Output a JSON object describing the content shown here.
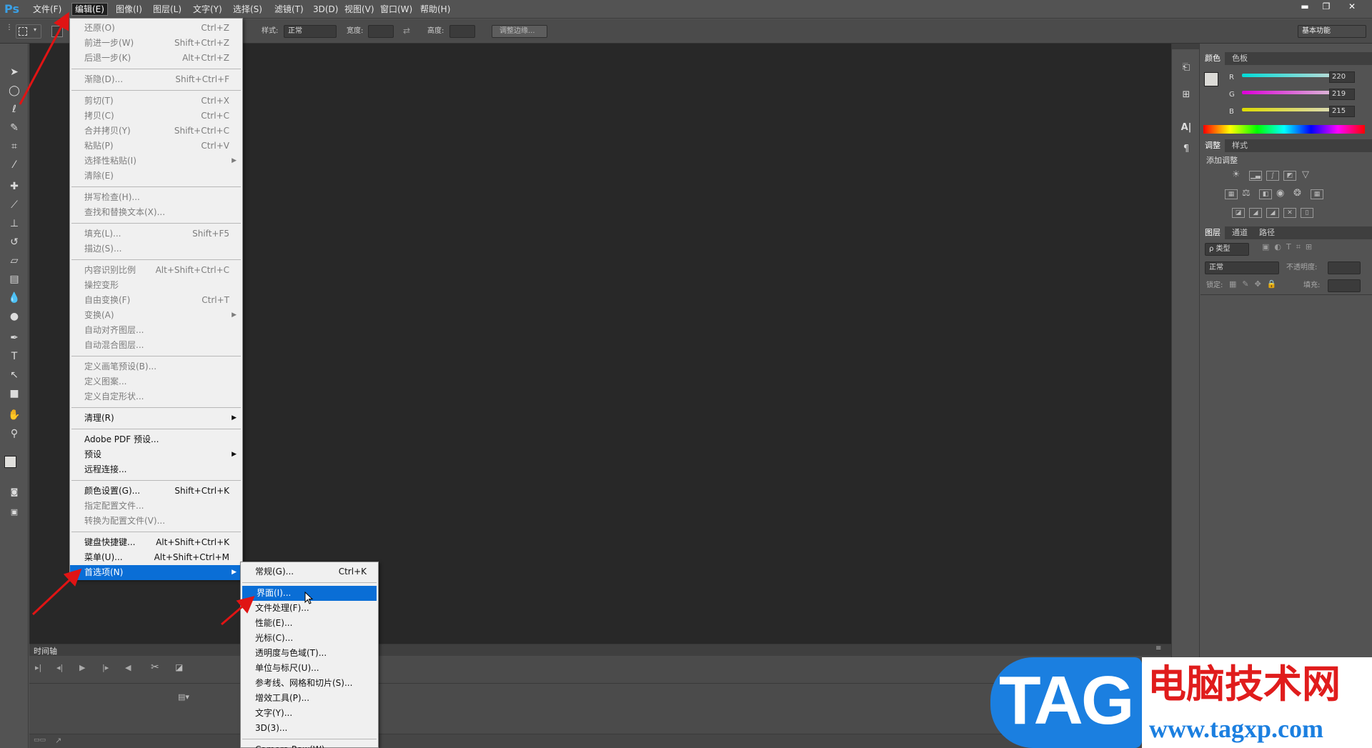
{
  "app": {
    "logo": "Ps"
  },
  "menubar": [
    {
      "label": "文件(F)",
      "active": false
    },
    {
      "label": "编辑(E)",
      "active": true
    },
    {
      "label": "图像(I)",
      "active": false
    },
    {
      "label": "图层(L)",
      "active": false
    },
    {
      "label": "文字(Y)",
      "active": false
    },
    {
      "label": "选择(S)",
      "active": false
    },
    {
      "label": "滤镜(T)",
      "active": false
    },
    {
      "label": "3D(D)",
      "active": false
    },
    {
      "label": "视图(V)",
      "active": false
    },
    {
      "label": "窗口(W)",
      "active": false
    },
    {
      "label": "帮助(H)",
      "active": false
    }
  ],
  "window_controls": {
    "minimize": "▬",
    "restore": "❐",
    "close": "✕"
  },
  "options_bar": {
    "style_label": "样式:",
    "style_value": "正常",
    "width_label": "宽度:",
    "height_label": "高度:",
    "refine_edge": "调整边缘...",
    "workspace": "基本功能"
  },
  "edit_menu": [
    {
      "label": "还原(O)",
      "shortcut": "Ctrl+Z",
      "disabled": true
    },
    {
      "label": "前进一步(W)",
      "shortcut": "Shift+Ctrl+Z",
      "disabled": true
    },
    {
      "label": "后退一步(K)",
      "shortcut": "Alt+Ctrl+Z",
      "disabled": true
    },
    {
      "sep": true
    },
    {
      "label": "渐隐(D)...",
      "shortcut": "Shift+Ctrl+F",
      "disabled": true
    },
    {
      "sep": true
    },
    {
      "label": "剪切(T)",
      "shortcut": "Ctrl+X",
      "disabled": true
    },
    {
      "label": "拷贝(C)",
      "shortcut": "Ctrl+C",
      "disabled": true
    },
    {
      "label": "合并拷贝(Y)",
      "shortcut": "Shift+Ctrl+C",
      "disabled": true
    },
    {
      "label": "粘贴(P)",
      "shortcut": "Ctrl+V",
      "disabled": true
    },
    {
      "label": "选择性粘贴(I)",
      "submenu": true,
      "disabled": true
    },
    {
      "label": "清除(E)",
      "disabled": true
    },
    {
      "sep": true
    },
    {
      "label": "拼写检查(H)...",
      "disabled": true
    },
    {
      "label": "查找和替换文本(X)...",
      "disabled": true
    },
    {
      "sep": true
    },
    {
      "label": "填充(L)...",
      "shortcut": "Shift+F5",
      "disabled": true
    },
    {
      "label": "描边(S)...",
      "disabled": true
    },
    {
      "sep": true
    },
    {
      "label": "内容识别比例",
      "shortcut": "Alt+Shift+Ctrl+C",
      "disabled": true
    },
    {
      "label": "操控变形",
      "disabled": true
    },
    {
      "label": "自由变换(F)",
      "shortcut": "Ctrl+T",
      "disabled": true
    },
    {
      "label": "变换(A)",
      "submenu": true,
      "disabled": true
    },
    {
      "label": "自动对齐图层...",
      "disabled": true
    },
    {
      "label": "自动混合图层...",
      "disabled": true
    },
    {
      "sep": true
    },
    {
      "label": "定义画笔预设(B)...",
      "disabled": true
    },
    {
      "label": "定义图案...",
      "disabled": true
    },
    {
      "label": "定义自定形状...",
      "disabled": true
    },
    {
      "sep": true
    },
    {
      "label": "清理(R)",
      "submenu": true,
      "disabled": false
    },
    {
      "sep": true
    },
    {
      "label": "Adobe PDF 预设...",
      "disabled": false
    },
    {
      "label": "预设",
      "submenu": true,
      "disabled": false
    },
    {
      "label": "远程连接...",
      "disabled": false
    },
    {
      "sep": true
    },
    {
      "label": "颜色设置(G)...",
      "shortcut": "Shift+Ctrl+K",
      "disabled": false
    },
    {
      "label": "指定配置文件...",
      "disabled": true
    },
    {
      "label": "转换为配置文件(V)...",
      "disabled": true
    },
    {
      "sep": true
    },
    {
      "label": "键盘快捷键...",
      "shortcut": "Alt+Shift+Ctrl+K",
      "disabled": false
    },
    {
      "label": "菜单(U)...",
      "shortcut": "Alt+Shift+Ctrl+M",
      "disabled": false
    },
    {
      "label": "首选项(N)",
      "submenu": true,
      "disabled": false,
      "highlighted": true
    }
  ],
  "prefs_submenu": [
    {
      "label": "常规(G)...",
      "shortcut": "Ctrl+K"
    },
    {
      "sep": true
    },
    {
      "label": "界面(I)...",
      "highlighted": true
    },
    {
      "label": "文件处理(F)..."
    },
    {
      "label": "性能(E)..."
    },
    {
      "label": "光标(C)..."
    },
    {
      "label": "透明度与色域(T)..."
    },
    {
      "label": "单位与标尺(U)..."
    },
    {
      "label": "参考线、网格和切片(S)..."
    },
    {
      "label": "增效工具(P)..."
    },
    {
      "label": "文字(Y)..."
    },
    {
      "label": "3D(3)..."
    },
    {
      "sep": true
    },
    {
      "label": "Camera Raw(W)..."
    }
  ],
  "color_panel": {
    "tabs": [
      "颜色",
      "色板"
    ],
    "channels": [
      {
        "label": "R",
        "value": "220"
      },
      {
        "label": "G",
        "value": "219"
      },
      {
        "label": "B",
        "value": "215"
      }
    ]
  },
  "adjust_panel": {
    "tabs": [
      "调整",
      "样式"
    ],
    "heading": "添加调整"
  },
  "layers_panel": {
    "tabs": [
      "图层",
      "通道",
      "路径"
    ],
    "kind": "ρ 类型",
    "blend_mode": "正常",
    "opacity_label": "不透明度:",
    "lock_label": "锁定:",
    "fill_label": "填充:"
  },
  "timeline": {
    "title": "时间轴"
  },
  "watermark": {
    "tag": "TAG",
    "site_name": "电脑技术网",
    "url": "www.tagxp.com"
  }
}
